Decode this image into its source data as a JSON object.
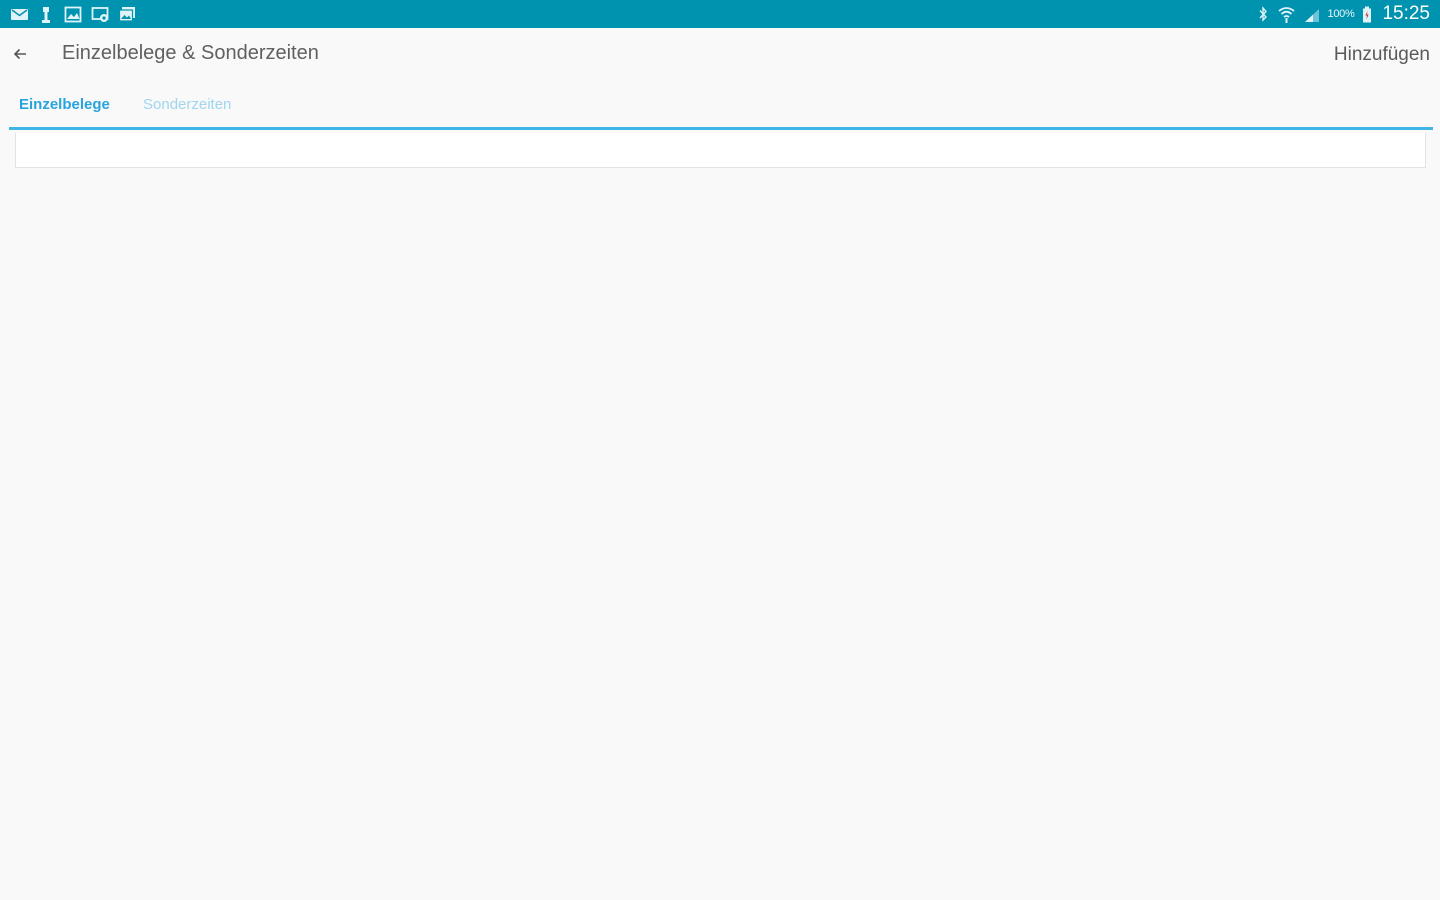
{
  "status_bar": {
    "left_icons": [
      "mail-icon",
      "usb-icon",
      "image-icon",
      "cast-icon",
      "gallery-icon"
    ],
    "right_icons": [
      "bluetooth-icon",
      "wifi-icon",
      "signal-icon"
    ],
    "battery_percent": "100%",
    "time": "15:25",
    "background_color": "#0093b0"
  },
  "header": {
    "title": "Einzelbelege & Sonderzeiten",
    "action_label": "Hinzufügen"
  },
  "tabs": [
    {
      "label": "Einzelbelege",
      "selected": true
    },
    {
      "label": "Sonderzeiten",
      "selected": false
    }
  ],
  "colors": {
    "accent": "#3fb4e5",
    "tab_active": "#27a4de",
    "tab_inactive": "#9fd6ef"
  }
}
